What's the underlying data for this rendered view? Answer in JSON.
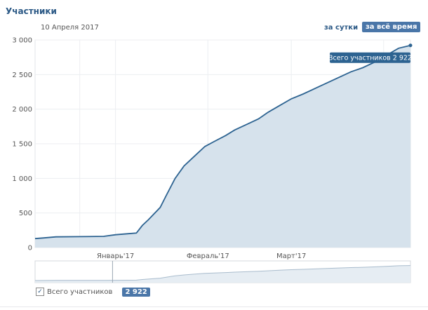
{
  "header": {
    "title": "Участники",
    "date": "10 Апреля 2017",
    "btn_day": "за сутки",
    "btn_all": "за всё время"
  },
  "tooltip": "Всего участников 2 922",
  "legend": {
    "label": "Всего участников",
    "value": "2 922",
    "checked": true
  },
  "colors": {
    "line": "#2d6391",
    "fill": "#d6e2ec",
    "accent": "#4a76a8"
  },
  "chart_data": {
    "type": "area",
    "ylim": [
      0,
      3000
    ],
    "yticks": [
      0,
      500,
      1000,
      1500,
      2000,
      2500,
      3000
    ],
    "ytick_labels": [
      "0",
      "500",
      "1 000",
      "1 500",
      "2 000",
      "2 500",
      "3 000"
    ],
    "xlim": [
      "2016-12-05",
      "2017-04-10"
    ],
    "xticks": [
      {
        "date": "2017-01-01",
        "label": "Январь'17"
      },
      {
        "date": "2017-02-01",
        "label": "Февраль'17"
      },
      {
        "date": "2017-03-01",
        "label": "Март'17"
      }
    ],
    "grid": true,
    "series": [
      {
        "name": "Всего участников",
        "points": [
          [
            "2016-12-05",
            130
          ],
          [
            "2016-12-08",
            140
          ],
          [
            "2016-12-12",
            155
          ],
          [
            "2016-12-20",
            158
          ],
          [
            "2016-12-28",
            162
          ],
          [
            "2017-01-01",
            185
          ],
          [
            "2017-01-05",
            200
          ],
          [
            "2017-01-08",
            210
          ],
          [
            "2017-01-10",
            320
          ],
          [
            "2017-01-12",
            400
          ],
          [
            "2017-01-16",
            580
          ],
          [
            "2017-01-18",
            750
          ],
          [
            "2017-01-21",
            1000
          ],
          [
            "2017-01-24",
            1180
          ],
          [
            "2017-01-27",
            1300
          ],
          [
            "2017-01-31",
            1460
          ],
          [
            "2017-02-03",
            1530
          ],
          [
            "2017-02-07",
            1620
          ],
          [
            "2017-02-10",
            1700
          ],
          [
            "2017-02-14",
            1780
          ],
          [
            "2017-02-18",
            1860
          ],
          [
            "2017-02-21",
            1950
          ],
          [
            "2017-02-25",
            2050
          ],
          [
            "2017-03-01",
            2150
          ],
          [
            "2017-03-05",
            2220
          ],
          [
            "2017-03-09",
            2300
          ],
          [
            "2017-03-13",
            2380
          ],
          [
            "2017-03-17",
            2460
          ],
          [
            "2017-03-21",
            2540
          ],
          [
            "2017-03-25",
            2600
          ],
          [
            "2017-03-29",
            2680
          ],
          [
            "2017-04-02",
            2780
          ],
          [
            "2017-04-06",
            2880
          ],
          [
            "2017-04-10",
            2922
          ]
        ]
      }
    ]
  }
}
